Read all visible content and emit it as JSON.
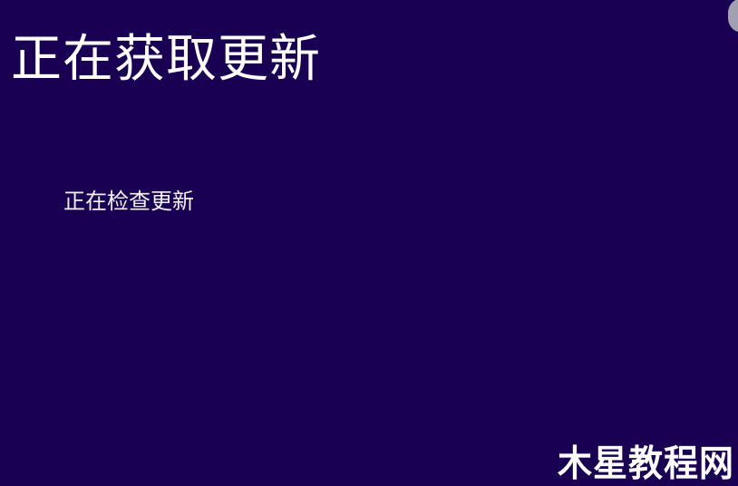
{
  "screen": {
    "title": "正在获取更新",
    "status": "正在检查更新",
    "background_color": "#1a0052",
    "text_color": "#ffffff"
  },
  "watermark": {
    "text": "木星教程网"
  }
}
